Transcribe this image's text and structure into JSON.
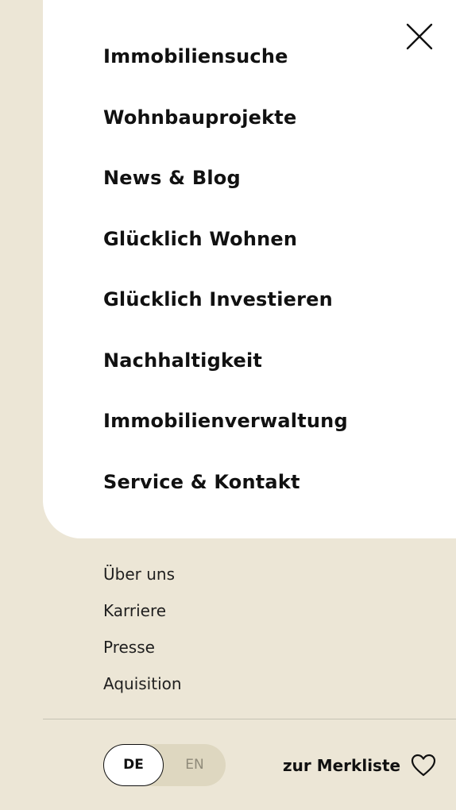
{
  "menu": {
    "main_items": [
      {
        "label": "Immobiliensuche"
      },
      {
        "label": "Wohnbauprojekte"
      },
      {
        "label": "News & Blog"
      },
      {
        "label": "Glücklich Wohnen"
      },
      {
        "label": "Glücklich Investieren"
      },
      {
        "label": "Nachhaltigkeit"
      },
      {
        "label": "Immobilienverwaltung"
      },
      {
        "label": "Service & Kontakt"
      }
    ],
    "close_icon": "close-icon"
  },
  "secondary": {
    "items": [
      {
        "label": "Über uns"
      },
      {
        "label": "Karriere"
      },
      {
        "label": "Presse"
      },
      {
        "label": "Aquisition"
      }
    ]
  },
  "footer": {
    "languages": {
      "active": "DE",
      "inactive": "EN"
    },
    "wishlist_label": "zur Merkliste",
    "wishlist_icon": "heart-icon"
  },
  "colors": {
    "background": "#ece6d6",
    "panel": "#ffffff",
    "text": "#111111",
    "lang_track": "#ded7c0",
    "lang_inactive": "#8f8a79"
  }
}
